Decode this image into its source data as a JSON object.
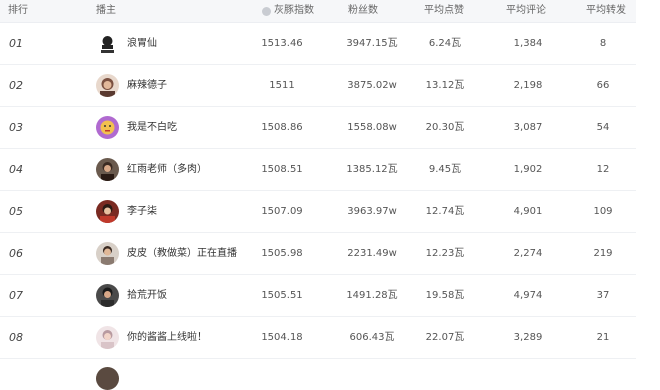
{
  "header": {
    "rank": "排行",
    "anchor": "播主",
    "index": "灰豚指数",
    "fans": "粉丝数",
    "avg_likes": "平均点赞",
    "avg_comments": "平均评论",
    "avg_shares": "平均转发"
  },
  "rows": [
    {
      "rank": "01",
      "name": "浪胃仙",
      "index": "1513.46",
      "fans": "3947.15瓦",
      "likes": "6.24瓦",
      "comments": "1,384",
      "shares": "8",
      "avatar_color": "#222222"
    },
    {
      "rank": "02",
      "name": "麻辣德子",
      "index": "1511",
      "fans": "3875.02w",
      "likes": "13.12瓦",
      "comments": "2,198",
      "shares": "66",
      "avatar_color": "#7a5040"
    },
    {
      "rank": "03",
      "name": "我是不白吃",
      "index": "1508.86",
      "fans": "1558.08w",
      "likes": "20.30瓦",
      "comments": "3,087",
      "shares": "54",
      "avatar_color": "#b06ad0"
    },
    {
      "rank": "04",
      "name": "红雨老师（多肉）",
      "index": "1508.51",
      "fans": "1385.12瓦",
      "likes": "9.45瓦",
      "comments": "1,902",
      "shares": "12",
      "avatar_color": "#3a2a22"
    },
    {
      "rank": "05",
      "name": "李子柒",
      "index": "1507.09",
      "fans": "3963.97w",
      "likes": "12.74瓦",
      "comments": "4,901",
      "shares": "109",
      "avatar_color": "#c0392b"
    },
    {
      "rank": "06",
      "name": "皮皮（教做菜）正在直播",
      "index": "1505.98",
      "fans": "2231.49w",
      "likes": "12.23瓦",
      "comments": "2,274",
      "shares": "219",
      "avatar_color": "#8a7a70"
    },
    {
      "rank": "07",
      "name": "拾荒开饭",
      "index": "1505.51",
      "fans": "1491.28瓦",
      "likes": "19.58瓦",
      "comments": "4,974",
      "shares": "37",
      "avatar_color": "#2c2c2c"
    },
    {
      "rank": "08",
      "name": "你的酱酱上线啦！",
      "index": "1504.18",
      "fans": "606.43瓦",
      "likes": "22.07瓦",
      "comments": "3,289",
      "shares": "21",
      "avatar_color": "#d9c4c8"
    }
  ]
}
